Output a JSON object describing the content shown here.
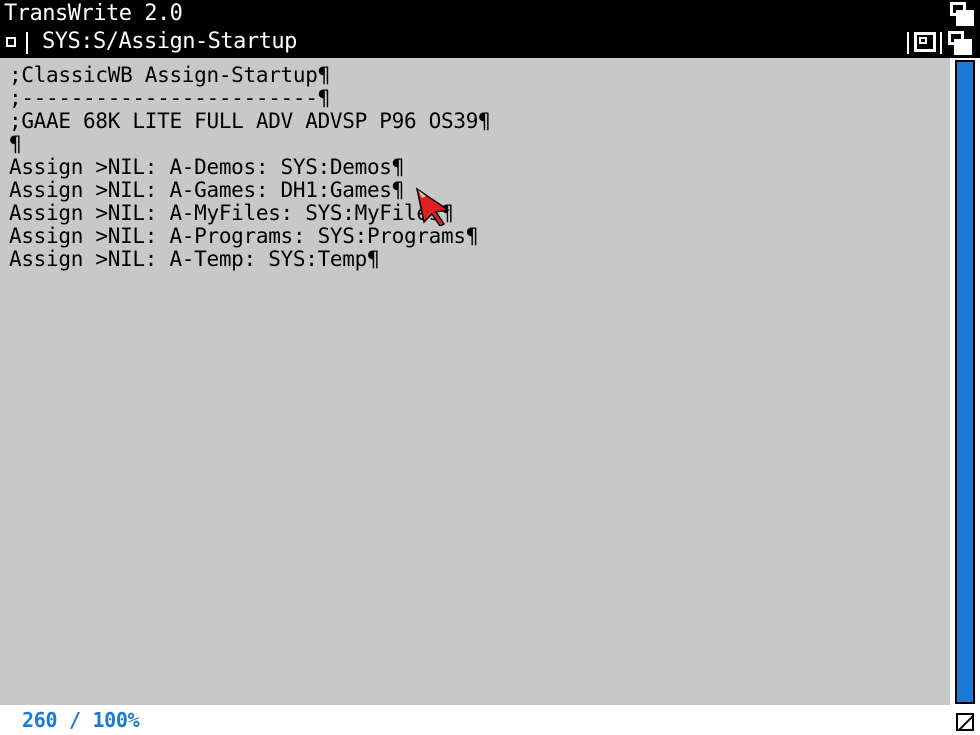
{
  "screen": {
    "title": "TransWrite 2.0"
  },
  "window": {
    "title": "SYS:S/Assign-Startup"
  },
  "editor": {
    "lines": [
      ";ClassicWB Assign-Startup¶",
      ";------------------------¶",
      ";GAAE 68K LITE FULL ADV ADVSP P96 OS39¶",
      "¶",
      "Assign >NIL: A-Demos: SYS:Demos¶",
      "Assign >NIL: A-Games: DH1:Games¶",
      "Assign >NIL: A-MyFiles: SYS:MyFiles¶",
      "Assign >NIL: A-Programs: SYS:Programs¶",
      "Assign >NIL: A-Temp: SYS:Temp¶"
    ]
  },
  "status": {
    "text": "260 / 100%"
  },
  "icons": {
    "close": "close-icon",
    "zoom": "zoom-icon",
    "depth": "depth-icon",
    "size": "resize-icon",
    "pointer": "mouse-pointer-icon"
  },
  "colors": {
    "background": "#c8c8c8",
    "titlebar": "#000000",
    "accent": "#1a7ad6",
    "pointer": "#e02020"
  }
}
